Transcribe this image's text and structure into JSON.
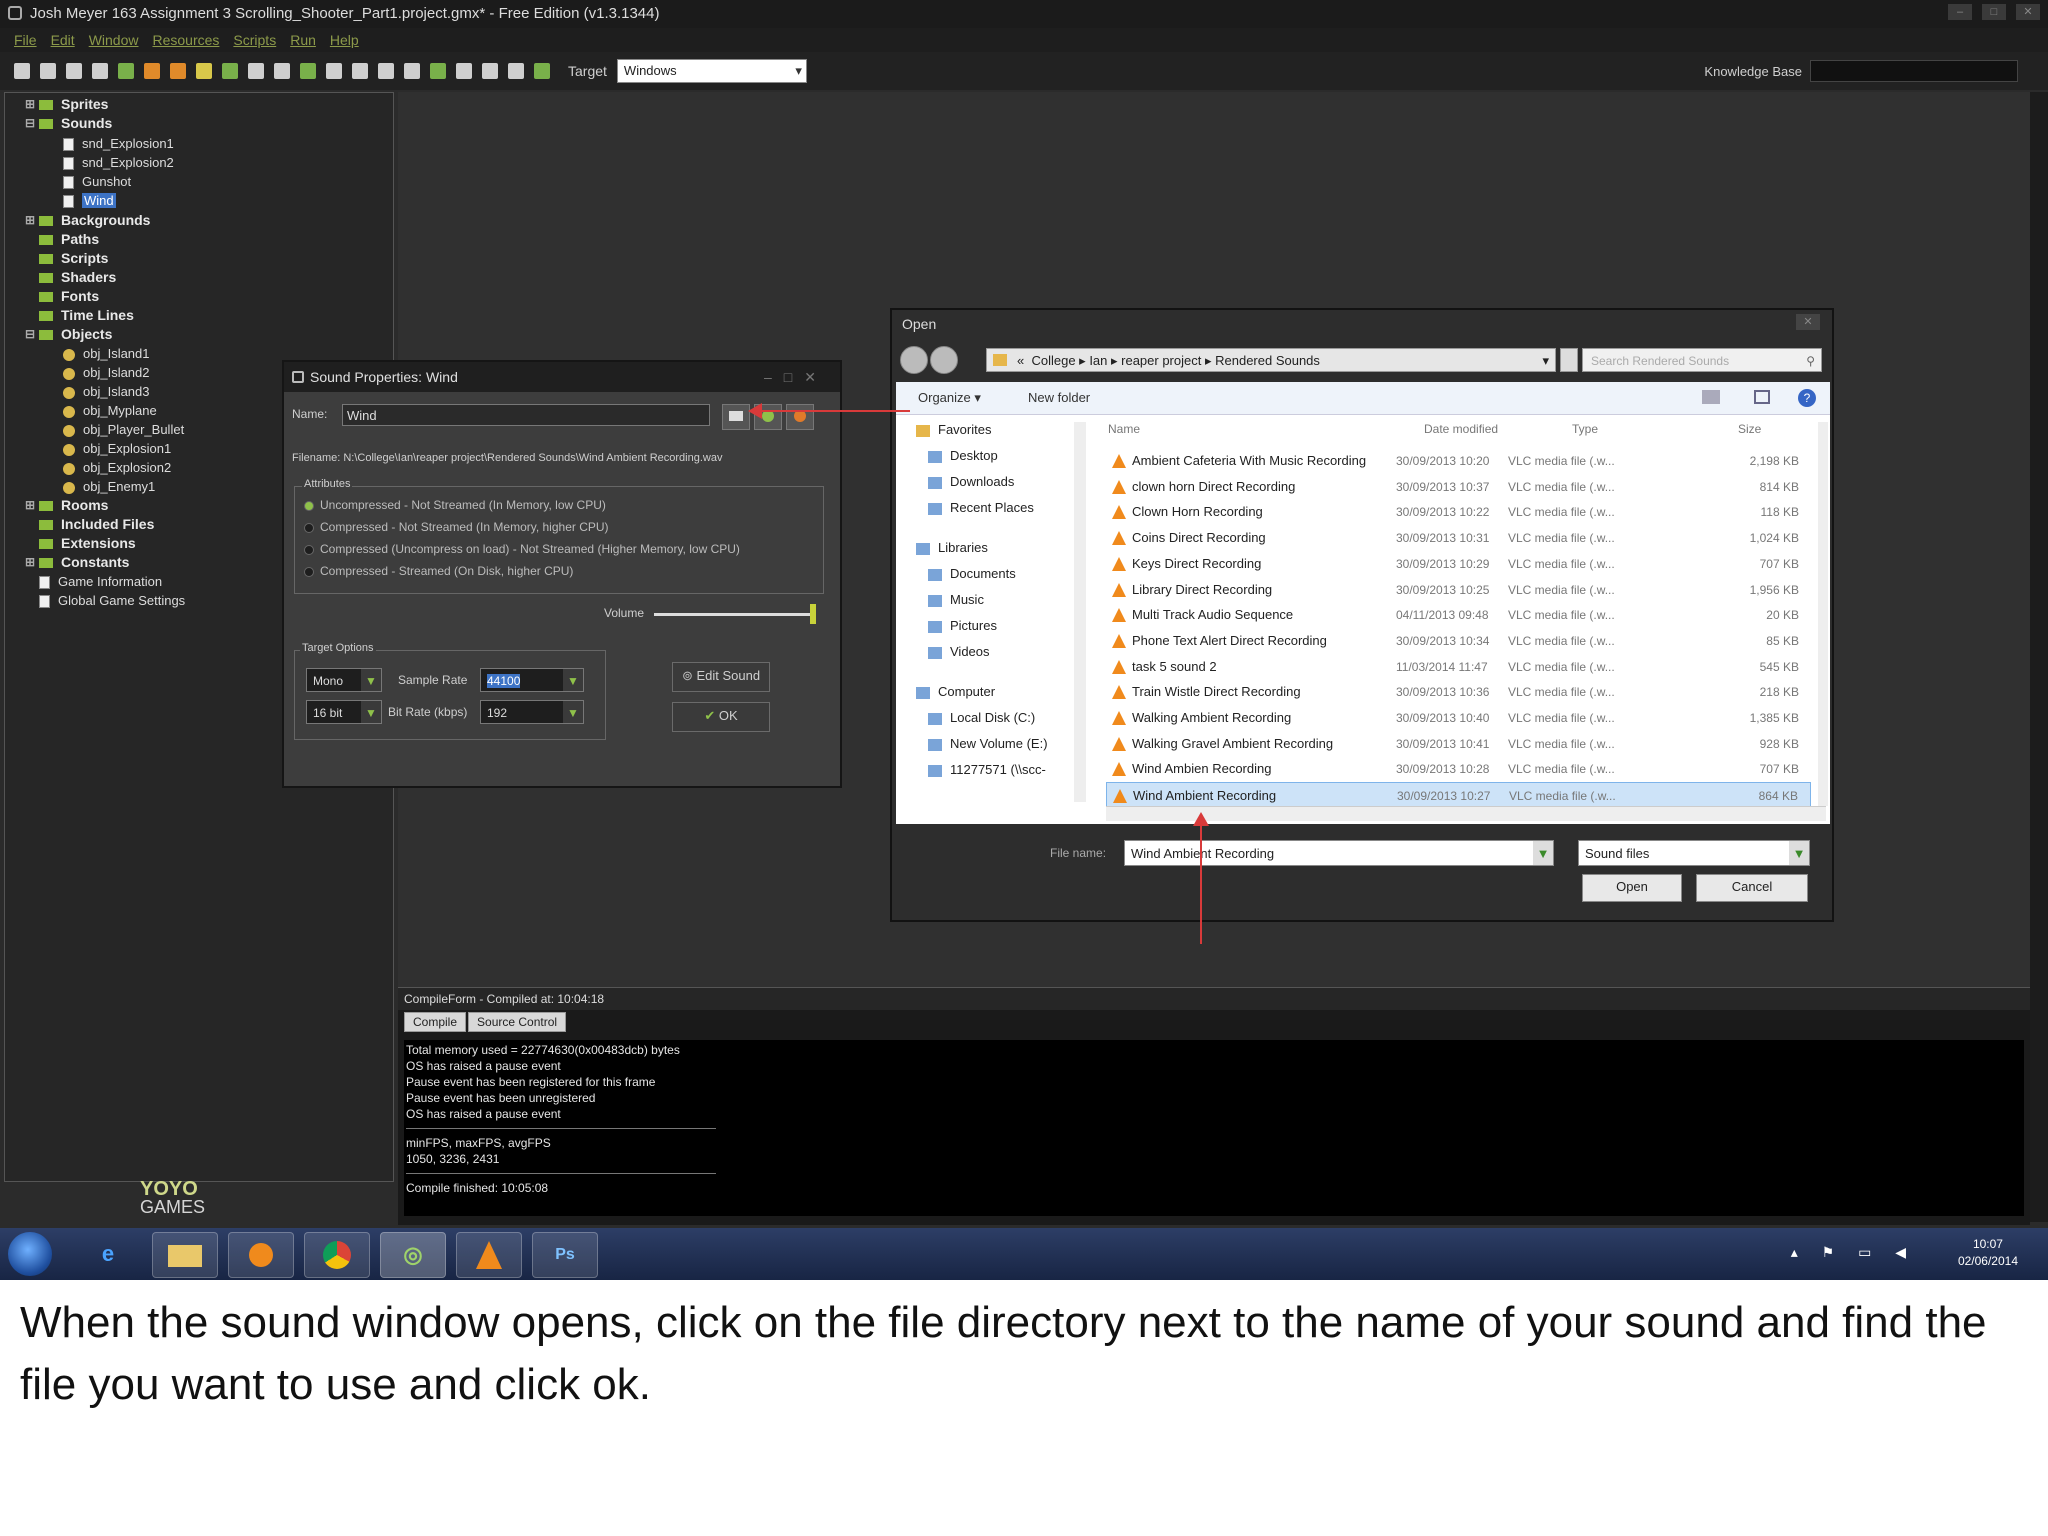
{
  "window": {
    "title": "Josh Meyer 163 Assignment 3 Scrolling_Shooter_Part1.project.gmx* - Free Edition (v1.3.1344)"
  },
  "menu": [
    "File",
    "Edit",
    "Window",
    "Resources",
    "Scripts",
    "Run",
    "Help"
  ],
  "toolbar": {
    "target_label": "Target",
    "target_value": "Windows",
    "knowledge_label": "Knowledge Base"
  },
  "tree": {
    "sprites": "Sprites",
    "sounds": "Sounds",
    "sound_items": [
      "snd_Explosion1",
      "snd_Explosion2",
      "Gunshot",
      "Wind"
    ],
    "backgrounds": "Backgrounds",
    "paths": "Paths",
    "scripts": "Scripts",
    "shaders": "Shaders",
    "fonts": "Fonts",
    "timelines": "Time Lines",
    "objects": "Objects",
    "object_items": [
      "obj_Island1",
      "obj_Island2",
      "obj_Island3",
      "obj_Myplane",
      "obj_Player_Bullet",
      "obj_Explosion1",
      "obj_Explosion2",
      "obj_Enemy1"
    ],
    "rooms": "Rooms",
    "included": "Included Files",
    "extensions": "Extensions",
    "constants": "Constants",
    "gameinfo": "Game Information",
    "globalsettings": "Global Game Settings"
  },
  "brand": {
    "top": "YOYO",
    "bottom": "GAMES"
  },
  "sound_props": {
    "title": "Sound Properties: Wind",
    "name_label": "Name:",
    "name_value": "Wind",
    "filename": "Filename: N:\\College\\Ian\\reaper project\\Rendered Sounds\\Wind Ambient Recording.wav",
    "attributes_label": "Attributes",
    "attributes": [
      "Uncompressed - Not Streamed (In Memory, low CPU)",
      "Compressed - Not Streamed (In Memory, higher CPU)",
      "Compressed (Uncompress on load) - Not Streamed (Higher Memory, low CPU)",
      "Compressed - Streamed (On Disk, higher CPU)"
    ],
    "volume_label": "Volume",
    "target_options_label": "Target Options",
    "channel": "Mono",
    "sample_rate_label": "Sample Rate",
    "sample_rate": "44100",
    "bits": "16 bit",
    "bit_rate_label": "Bit Rate (kbps)",
    "bit_rate": "192",
    "edit_sound": "Edit Sound",
    "ok": "OK"
  },
  "open_dialog": {
    "title": "Open",
    "path": [
      "College",
      "Ian",
      "reaper project",
      "Rendered Sounds"
    ],
    "search_placeholder": "Search Rendered Sounds",
    "organize": "Organize",
    "new_folder": "New folder",
    "nav": {
      "favorites": "Favorites",
      "desktop": "Desktop",
      "downloads": "Downloads",
      "recent": "Recent Places",
      "libraries": "Libraries",
      "documents": "Documents",
      "music": "Music",
      "pictures": "Pictures",
      "videos": "Videos",
      "computer": "Computer",
      "local_disk": "Local Disk (C:)",
      "new_volume": "New Volume (E:)",
      "network": "11277571 (\\\\scc-"
    },
    "columns": {
      "name": "Name",
      "date": "Date modified",
      "type": "Type",
      "size": "Size"
    },
    "files": [
      {
        "name": "Ambient Cafeteria With Music Recording",
        "date": "30/09/2013 10:20",
        "type": "VLC media file (.w...",
        "size": "2,198 KB"
      },
      {
        "name": "clown horn Direct Recording",
        "date": "30/09/2013 10:37",
        "type": "VLC media file (.w...",
        "size": "814 KB"
      },
      {
        "name": "Clown Horn Recording",
        "date": "30/09/2013 10:22",
        "type": "VLC media file (.w...",
        "size": "118 KB"
      },
      {
        "name": "Coins Direct Recording",
        "date": "30/09/2013 10:31",
        "type": "VLC media file (.w...",
        "size": "1,024 KB"
      },
      {
        "name": "Keys Direct Recording",
        "date": "30/09/2013 10:29",
        "type": "VLC media file (.w...",
        "size": "707 KB"
      },
      {
        "name": "Library Direct Recording",
        "date": "30/09/2013 10:25",
        "type": "VLC media file (.w...",
        "size": "1,956 KB"
      },
      {
        "name": "Multi Track Audio Sequence",
        "date": "04/11/2013 09:48",
        "type": "VLC media file (.w...",
        "size": "20 KB"
      },
      {
        "name": "Phone Text Alert Direct Recording",
        "date": "30/09/2013 10:34",
        "type": "VLC media file (.w...",
        "size": "85 KB"
      },
      {
        "name": "task 5 sound 2",
        "date": "11/03/2014 11:47",
        "type": "VLC media file (.w...",
        "size": "545 KB"
      },
      {
        "name": "Train Wistle Direct Recording",
        "date": "30/09/2013 10:36",
        "type": "VLC media file (.w...",
        "size": "218 KB"
      },
      {
        "name": "Walking Ambient Recording",
        "date": "30/09/2013 10:40",
        "type": "VLC media file (.w...",
        "size": "1,385 KB"
      },
      {
        "name": "Walking Gravel Ambient Recording",
        "date": "30/09/2013 10:41",
        "type": "VLC media file (.w...",
        "size": "928 KB"
      },
      {
        "name": "Wind Ambien Recording",
        "date": "30/09/2013 10:28",
        "type": "VLC media file (.w...",
        "size": "707 KB"
      },
      {
        "name": "Wind Ambient Recording",
        "date": "30/09/2013 10:27",
        "type": "VLC media file (.w...",
        "size": "864 KB"
      }
    ],
    "file_name_label": "File name:",
    "file_name_value": "Wind Ambient Recording",
    "file_type": "Sound files",
    "open": "Open",
    "cancel": "Cancel"
  },
  "compile": {
    "title": "CompileForm - Compiled at: 10:04:18",
    "tabs": [
      "Compile",
      "Source Control"
    ],
    "log1": [
      "Total memory used = 22774630(0x00483dcb) bytes",
      "OS has raised a pause event",
      "Pause event has been registered for this frame",
      "Pause event has been unregistered",
      "OS has raised a pause event"
    ],
    "log2": [
      "minFPS, maxFPS, avgFPS",
      "1050, 3236, 2431"
    ],
    "log3": "Compile finished: 10:05:08"
  },
  "taskbar": {
    "photoshop": "Ps",
    "time": "10:07",
    "date": "02/06/2014"
  },
  "caption": "When the sound window opens, click on the file directory next to the name of your sound and find the file you want to use and click ok.",
  "colors": {
    "accent_green": "#8fc14a",
    "annotation_red": "#d83a3a",
    "selection_blue": "#cde3f8"
  }
}
